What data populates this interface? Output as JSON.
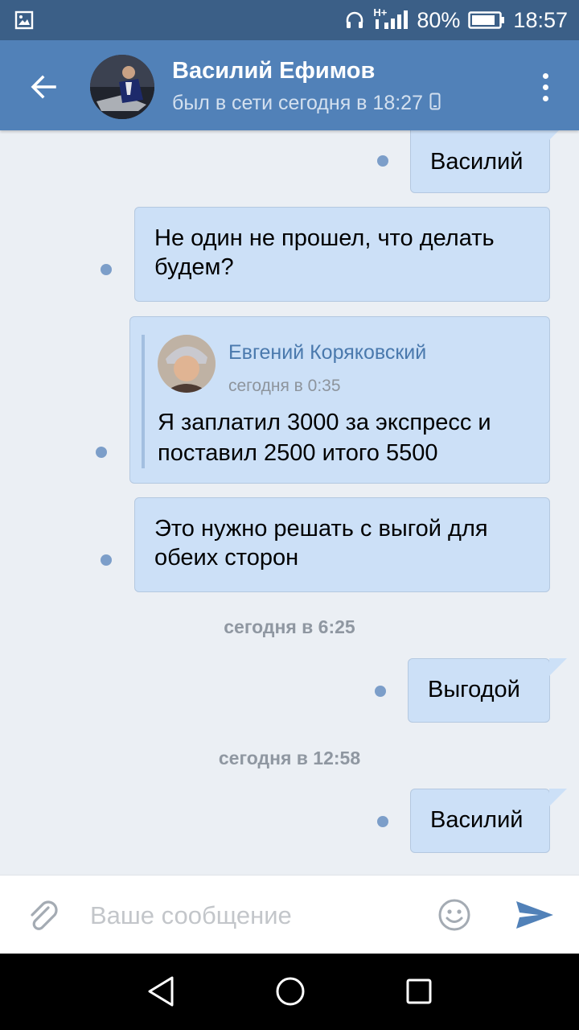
{
  "status_bar": {
    "network": "H+",
    "battery_percent": "80%",
    "time": "18:57"
  },
  "header": {
    "contact_name": "Василий Ефимов",
    "last_seen": "был в сети сегодня в 18:27"
  },
  "messages": [
    {
      "type": "outgoing",
      "text": "Василий"
    },
    {
      "type": "outgoing",
      "text": "Не один не прошел, что делать будем?"
    },
    {
      "type": "outgoing_forward",
      "forwarded": {
        "author": "Евгений Коряковский",
        "time": "сегодня в 0:35",
        "text": "Я заплатил 3000 за экспресс и поставил 2500 итого 5500"
      }
    },
    {
      "type": "outgoing",
      "text": "Это нужно решать с выгой для обеих сторон"
    },
    {
      "type": "date_separator",
      "text": "сегодня в 6:25"
    },
    {
      "type": "outgoing",
      "text": "Выгодой"
    },
    {
      "type": "date_separator",
      "text": "сегодня в 12:58"
    },
    {
      "type": "outgoing",
      "text": "Василий"
    }
  ],
  "composer": {
    "placeholder": "Ваше сообщение"
  },
  "colors": {
    "status_bar": "#3b5f87",
    "app_bar": "#5181b8",
    "chat_background": "#ebeff4",
    "bubble": "#cce0f7",
    "unread_dot": "#7c9ec9",
    "forward_author": "#4a79ad",
    "send_icon": "#5181b8"
  },
  "icons": {
    "status_left": "image-icon",
    "back": "arrow-left-icon",
    "more": "more-vertical-icon",
    "device": "mobile-device-icon",
    "attach": "paperclip-icon",
    "emoji": "smiley-icon",
    "send": "send-arrow-icon"
  }
}
